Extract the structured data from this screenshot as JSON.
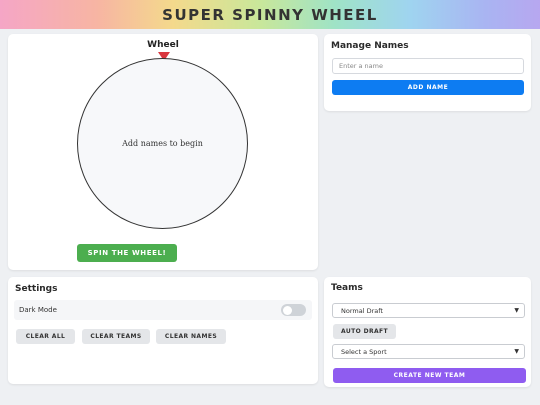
{
  "header": {
    "title": "SUPER SPINNY WHEEL"
  },
  "wheel": {
    "title": "Wheel",
    "empty_text": "Add names to begin",
    "spin_label": "SPIN THE WHEEL!"
  },
  "names": {
    "title": "Manage Names",
    "input_placeholder": "Enter a name",
    "add_label": "ADD NAME"
  },
  "settings": {
    "title": "Settings",
    "dark_mode_label": "Dark Mode",
    "dark_mode_on": false,
    "clear_all_label": "CLEAR ALL",
    "clear_teams_label": "CLEAR TEAMS",
    "clear_names_label": "CLEAR NAMES"
  },
  "teams": {
    "title": "Teams",
    "draft_mode_selected": "Normal Draft",
    "auto_draft_label": "AUTO DRAFT",
    "sport_selected": "Select a Sport",
    "create_label": "CREATE NEW TEAM"
  },
  "colors": {
    "spin_button": "#4cae4f",
    "add_button": "#0d7cf2",
    "create_button": "#8f5cf0",
    "pointer": "#d9363e"
  }
}
